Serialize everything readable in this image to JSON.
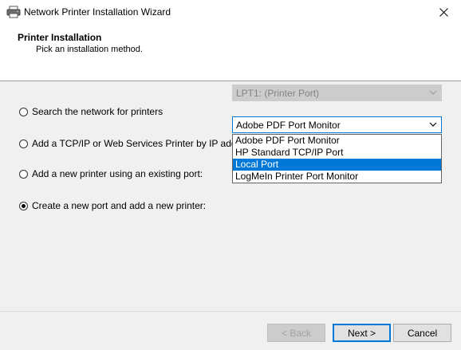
{
  "window": {
    "title": "Network Printer Installation Wizard",
    "icon": "printer-icon",
    "close_icon": "close-icon"
  },
  "header": {
    "title": "Printer Installation",
    "subtitle": "Pick an installation method."
  },
  "options": [
    {
      "label": "Search the network for printers",
      "checked": false
    },
    {
      "label": "Add a TCP/IP or Web Services Printer by IP address or hostname",
      "checked": false
    },
    {
      "label": "Add a new printer using an existing port:",
      "checked": false
    },
    {
      "label": "Create a new port and add a new printer:",
      "checked": true
    }
  ],
  "existing_port_combo": {
    "value": "LPT1: (Printer Port)",
    "enabled": false
  },
  "new_port_combo": {
    "value": "Adobe PDF Port Monitor",
    "expanded": true,
    "items": [
      "Adobe PDF Port Monitor",
      "HP Standard TCP/IP Port",
      "Local Port",
      "LogMeIn Printer Port Monitor"
    ],
    "highlighted": "Local Port"
  },
  "footer": {
    "back_label": "< Back",
    "next_label": "Next >",
    "cancel_label": "Cancel"
  },
  "colors": {
    "accent": "#0078d7",
    "panel_bg": "#f0f0f0"
  }
}
